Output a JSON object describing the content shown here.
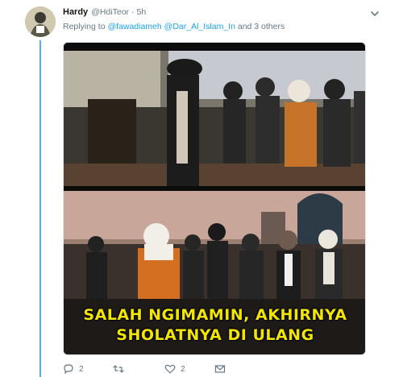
{
  "tweet": {
    "author_name": "Hardy",
    "author_handle": "@HdiTeor",
    "separator": "·",
    "time": "5h",
    "replying_prefix": "Replying to",
    "mention_1": "@fawadiameh",
    "mention_2": "@Dar_Al_Islam_In",
    "replying_suffix": "and 3 others",
    "caption_line_1": "SALAH NGIMAMIN, AKHIRNYA",
    "caption_line_2": "SHOLATNYA DI ULANG",
    "reply_count": "2",
    "retweet_count": "",
    "like_count": "2"
  },
  "colors": {
    "accent": "#1da1f2",
    "thread_line": "#4ab3f4",
    "muted_text": "#657786",
    "caption_text": "#f2e600"
  },
  "icons": {
    "reply": "reply-icon",
    "retweet": "retweet-icon",
    "like": "heart-icon",
    "message": "envelope-icon",
    "menu": "chevron-down-icon"
  }
}
